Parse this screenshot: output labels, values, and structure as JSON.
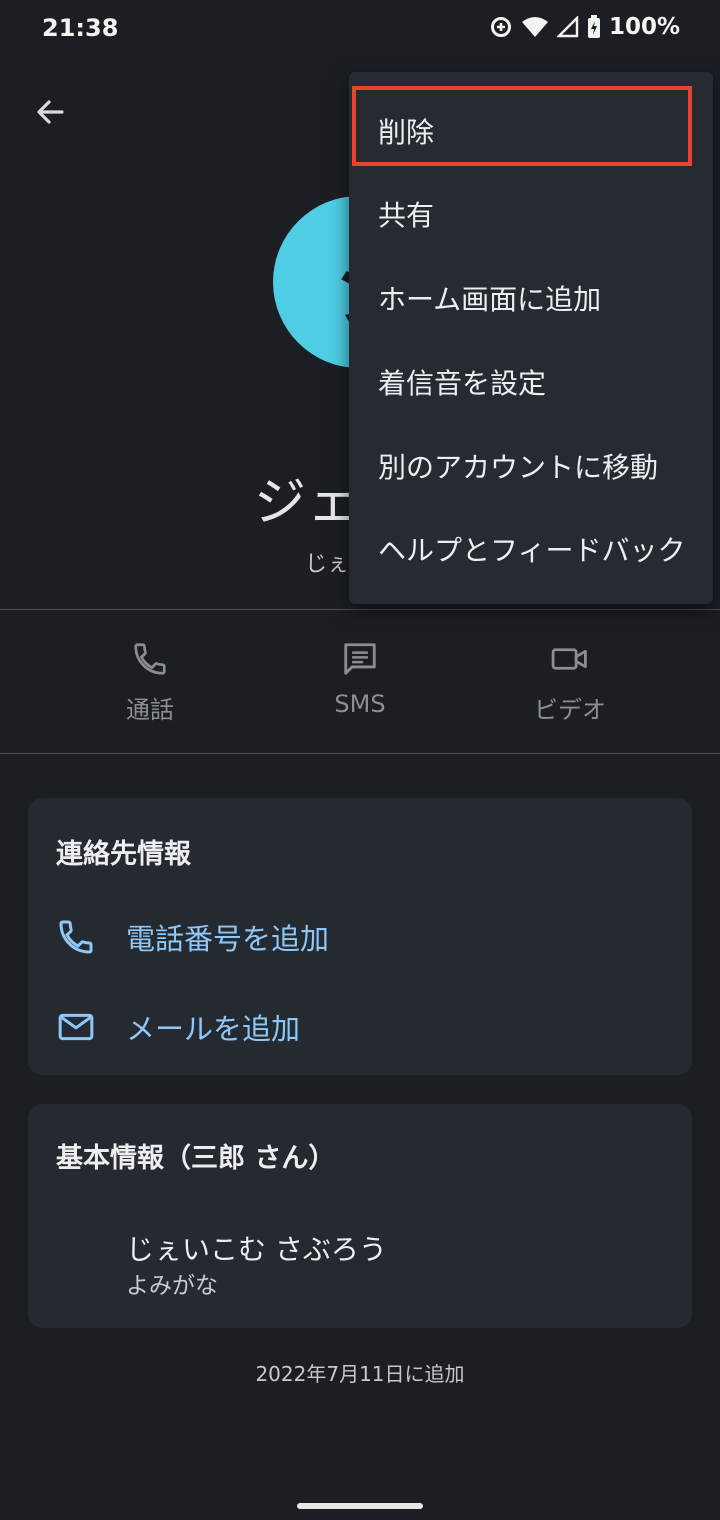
{
  "status_bar": {
    "time": "21:38",
    "battery": "100%",
    "icons": [
      "data-saver-icon",
      "wifi-icon",
      "signal-icon",
      "battery-charging-icon"
    ]
  },
  "header": {
    "back_icon": "arrow-back-icon"
  },
  "contact": {
    "avatar_letter": "ジ",
    "avatar_color": "#4fcde4",
    "name": "ジェイコ",
    "reading": "じぇいこむ"
  },
  "actions": [
    {
      "label": "通話",
      "icon": "phone-icon"
    },
    {
      "label": "SMS",
      "icon": "message-icon"
    },
    {
      "label": "ビデオ",
      "icon": "videocam-icon"
    }
  ],
  "contact_info_card": {
    "title": "連絡先情報",
    "rows": [
      {
        "label": "電話番号を追加",
        "icon": "phone-icon"
      },
      {
        "label": "メールを追加",
        "icon": "email-icon"
      }
    ]
  },
  "basic_info_card": {
    "title": "基本情報（三郎 さん）",
    "primary": "じぇいこむ さぶろう",
    "secondary": "よみがな"
  },
  "added_date": "2022年7月11日に追加",
  "menu": {
    "items": [
      {
        "label": "削除"
      },
      {
        "label": "共有"
      },
      {
        "label": "ホーム画面に追加"
      },
      {
        "label": "着信音を設定"
      },
      {
        "label": "別のアカウントに移動"
      },
      {
        "label": "ヘルプとフィードバック"
      }
    ],
    "highlight_color": "#e8452c"
  },
  "colors": {
    "background": "#1b1f24",
    "card": "#252a31",
    "link": "#8ec8f8",
    "menu": "#262b32"
  }
}
